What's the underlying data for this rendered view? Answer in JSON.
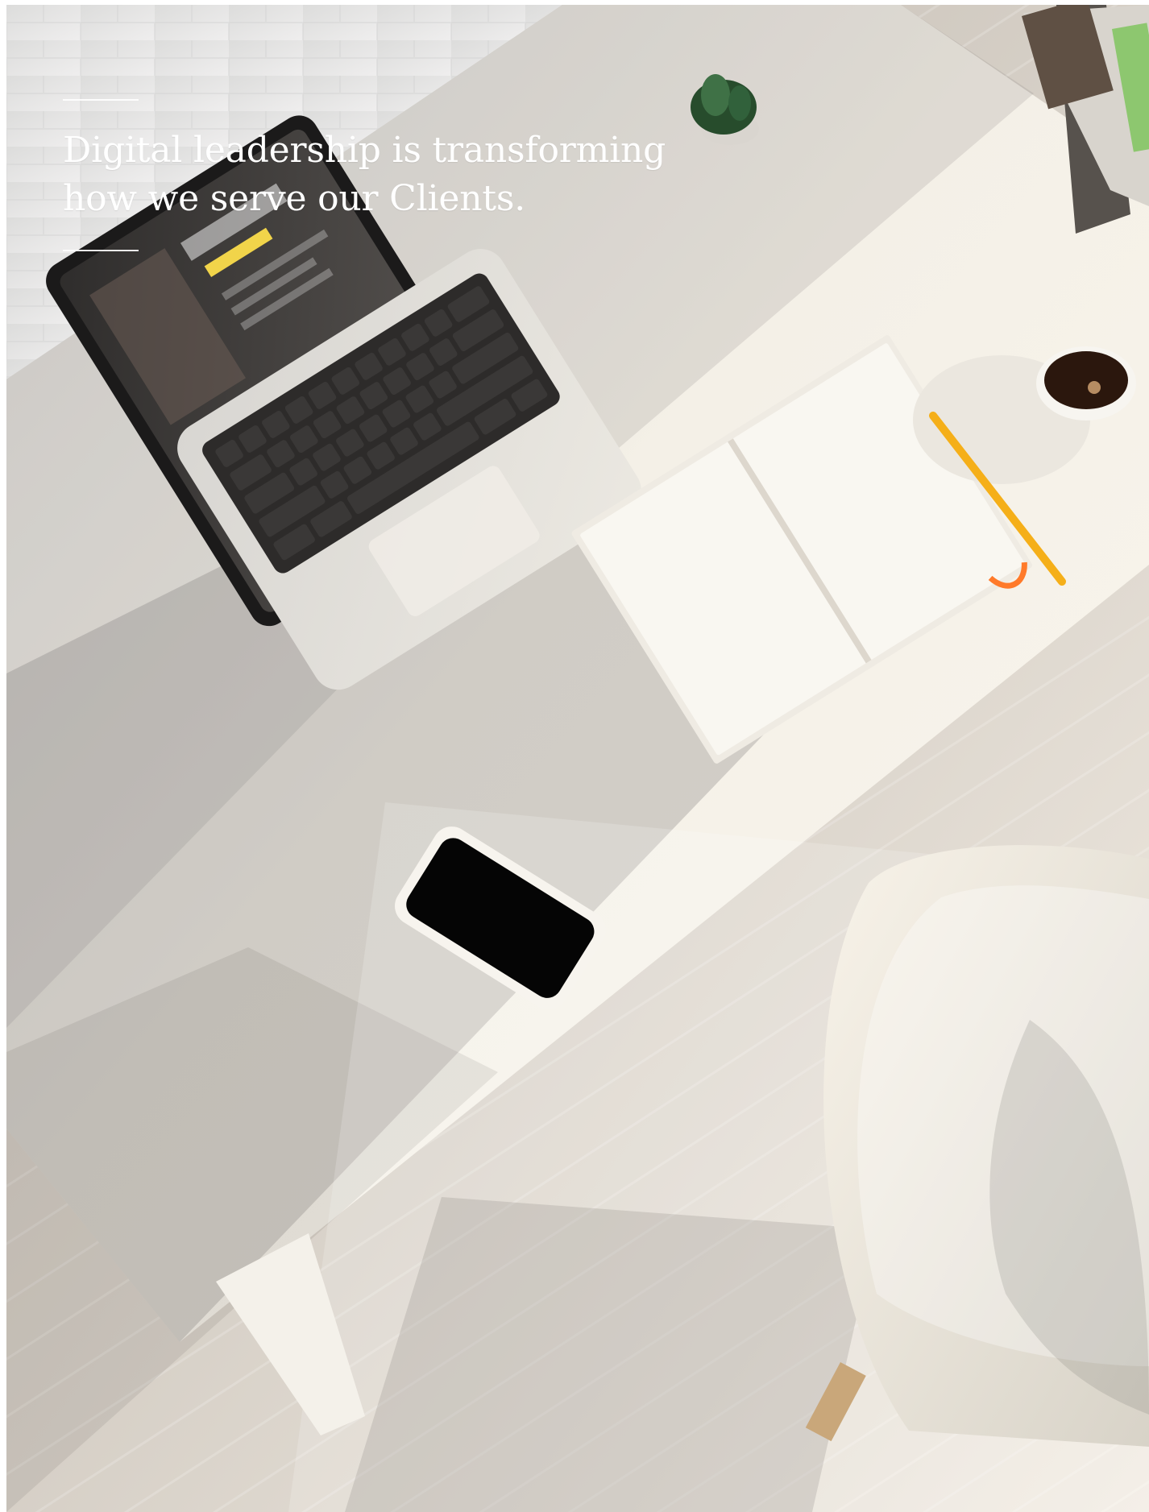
{
  "hero": {
    "headline_lines": [
      "Digital leadership is transforming",
      "how we serve our Clients."
    ]
  },
  "colors": {
    "headline_text": "#ffffff",
    "rules": "#ffffff",
    "desk": "#f3efe6",
    "wall": "#e7e5e2",
    "floor": "#d8d0c4",
    "shadow": "#b9b7b3"
  },
  "icons": {
    "hero_image": "desk-scene-image",
    "laptop": "laptop-image",
    "notebook": "notebook-image",
    "coffee": "coffee-cup-image",
    "phone": "phone-image",
    "chair": "chair-image",
    "plant": "plant-image",
    "pencil": "pencil-image"
  }
}
